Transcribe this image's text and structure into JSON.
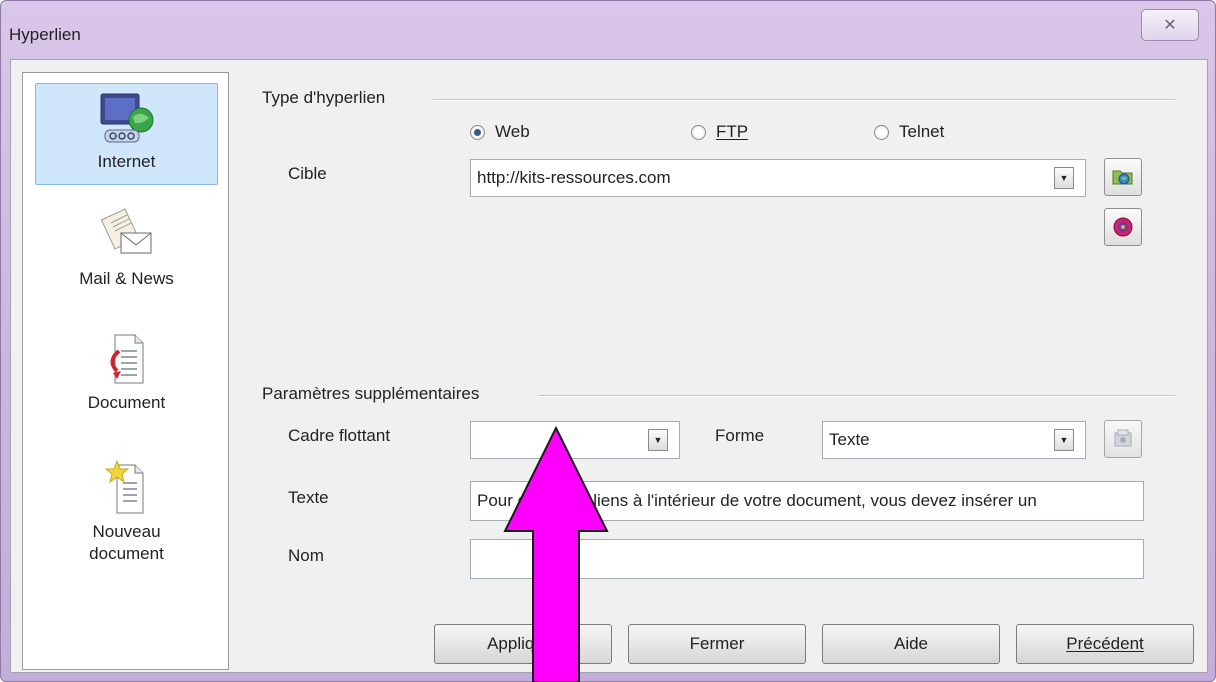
{
  "window": {
    "title": "Hyperlien",
    "close_symbol": "✕"
  },
  "sidebar": {
    "items": [
      {
        "label": "Internet",
        "icon": "internet-globe-icon",
        "selected": true
      },
      {
        "label": "Mail & News",
        "icon": "mail-news-icon",
        "selected": false
      },
      {
        "label": "Document",
        "icon": "document-icon",
        "selected": false
      },
      {
        "label": "Nouveau document",
        "label_lines": [
          "Nouveau",
          "document"
        ],
        "icon": "new-document-icon",
        "selected": false
      }
    ]
  },
  "hyperlink_type": {
    "group_label": "Type d'hyperlien",
    "options": [
      {
        "label": "Web",
        "checked": true
      },
      {
        "label": "FTP",
        "checked": false
      },
      {
        "label": "Telnet",
        "checked": false
      }
    ],
    "target_label": "Cible",
    "target_value": "http://kits-ressources.com"
  },
  "additional_settings": {
    "group_label": "Paramètres supplémentaires",
    "frame_label": "Cadre flottant",
    "frame_value": "",
    "form_label": "Forme",
    "form_value": "Texte",
    "text_label": "Texte",
    "text_value": "Pour créer des liens à l'intérieur de votre document, vous devez insérer un",
    "name_label": "Nom",
    "name_value": ""
  },
  "buttons": {
    "apply": "Appliquer",
    "close": "Fermer",
    "help": "Aide",
    "previous": "Précédent"
  },
  "colors": {
    "titlebar": "#ccb7df",
    "arrow": "#ff00ff",
    "selection": "#cfe6fb"
  }
}
